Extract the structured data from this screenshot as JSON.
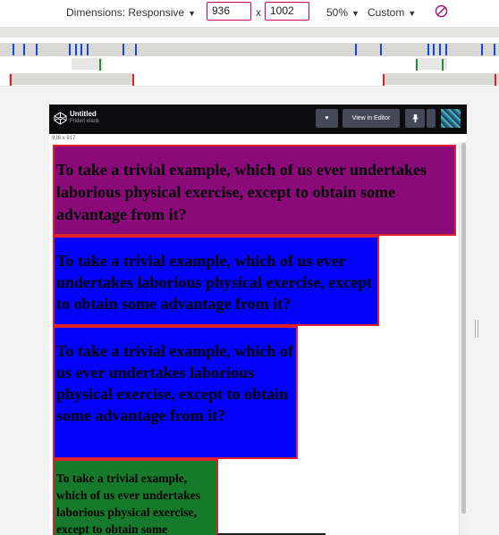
{
  "toolbar": {
    "dimensions_label": "Dimensions: Responsive",
    "width_value": "936",
    "times": "x",
    "height_value": "1002",
    "zoom": "50%",
    "throttle": "Custom"
  },
  "codepen": {
    "title": "Untitled",
    "author": "Frideri elank",
    "view_in_editor": "View in Editor",
    "size_readout": "936 x 917"
  },
  "boxes": [
    {
      "text": "To take a trivial example, which of us ever undertakes laborious physical exercise, except to obtain some advantage from it?",
      "color": "#8a0a79"
    },
    {
      "text": "To take a trivial example, which of us ever undertakes laborious physical exercise, except to obtain some advantage from it?",
      "color": "#0202fb"
    },
    {
      "text": "To take a trivial example, which of us ever undertakes laborious physical exercise, except to obtain some advantage from it?",
      "color": "#0202fb"
    },
    {
      "text": "To take a trivial example, which of us ever undertakes laborious physical exercise, except to obtain some advantage from it?",
      "color": "#157a2b"
    }
  ],
  "colors": {
    "border": "#e0202c",
    "media_query_blue": "#1a46d6",
    "media_query_green": "#2a8a3c",
    "media_query_red": "#e02020"
  },
  "icons": [
    "chevron-down-icon",
    "rotate-icon",
    "codepen-logo-icon",
    "heart-icon",
    "pin-icon"
  ]
}
